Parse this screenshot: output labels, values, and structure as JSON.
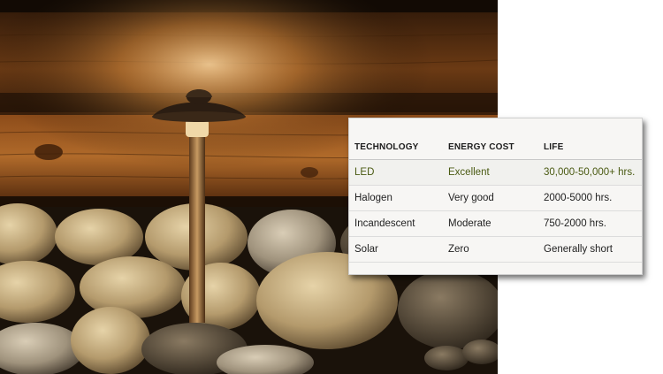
{
  "table": {
    "headers": [
      "TECHNOLOGY",
      "ENERGY COST",
      "LIFE"
    ],
    "rows": [
      [
        "LED",
        "Excellent",
        "30,000-50,000+ hrs."
      ],
      [
        "Halogen",
        "Very good",
        "2000-5000 hrs."
      ],
      [
        "Incandescent",
        "Moderate",
        "750-2000 hrs."
      ],
      [
        "Solar",
        "Zero",
        "Generally short"
      ]
    ],
    "highlight_row_color": "#4a5a12"
  },
  "photo": {
    "subject": "path-light-among-rocks",
    "colors": {
      "wood": "#8a4a18",
      "rock": "#b9a27a",
      "lamp": "#2b1d12"
    }
  }
}
